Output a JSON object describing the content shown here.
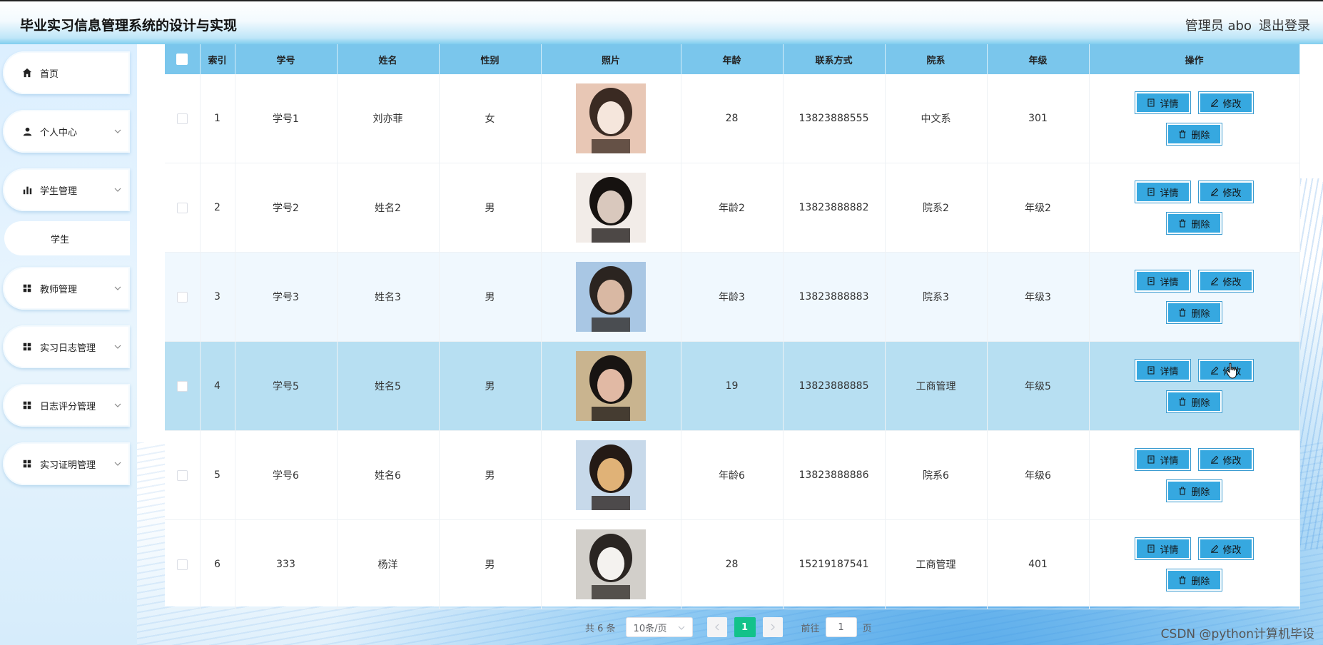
{
  "header": {
    "title": "毕业实习信息管理系统的设计与实现",
    "user": "管理员 abo",
    "logout": "退出登录"
  },
  "sidebar": {
    "items": [
      {
        "label": "首页",
        "icon": "home-icon"
      },
      {
        "label": "个人中心",
        "icon": "user-icon"
      },
      {
        "label": "学生管理",
        "icon": "bar-chart-icon"
      },
      {
        "label": "学生",
        "icon": ""
      },
      {
        "label": "教师管理",
        "icon": "grid-icon"
      },
      {
        "label": "实习日志管理",
        "icon": "grid-icon"
      },
      {
        "label": "日志评分管理",
        "icon": "grid-icon"
      },
      {
        "label": "实习证明管理",
        "icon": "grid-icon"
      }
    ]
  },
  "table": {
    "headers": [
      "",
      "索引",
      "学号",
      "姓名",
      "性别",
      "照片",
      "年龄",
      "联系方式",
      "院系",
      "年级",
      "操作"
    ],
    "rows": [
      {
        "index": "1",
        "id": "学号1",
        "name": "刘亦菲",
        "gender": "女",
        "age": "28",
        "phone": "13823888555",
        "dept": "中文系",
        "grade": "301"
      },
      {
        "index": "2",
        "id": "学号2",
        "name": "姓名2",
        "gender": "男",
        "age": "年龄2",
        "phone": "13823888882",
        "dept": "院系2",
        "grade": "年级2"
      },
      {
        "index": "3",
        "id": "学号3",
        "name": "姓名3",
        "gender": "男",
        "age": "年龄3",
        "phone": "13823888883",
        "dept": "院系3",
        "grade": "年级3"
      },
      {
        "index": "4",
        "id": "学号5",
        "name": "姓名5",
        "gender": "男",
        "age": "19",
        "phone": "13823888885",
        "dept": "工商管理",
        "grade": "年级5"
      },
      {
        "index": "5",
        "id": "学号6",
        "name": "姓名6",
        "gender": "男",
        "age": "年龄6",
        "phone": "13823888886",
        "dept": "院系6",
        "grade": "年级6"
      },
      {
        "index": "6",
        "id": "333",
        "name": "杨洋",
        "gender": "男",
        "age": "28",
        "phone": "15219187541",
        "dept": "工商管理",
        "grade": "401"
      }
    ],
    "buttons": {
      "detail": "详情",
      "edit": "修改",
      "delete": "删除"
    }
  },
  "pagination": {
    "total": "共 6 条",
    "page_size": "10条/页",
    "current": "1",
    "goto_prefix": "前往",
    "goto_value": "1",
    "goto_suffix": "页"
  },
  "watermark": "CSDN @python计算机毕设",
  "colors": {
    "header_accent": "#7ac6ec",
    "button": "#36a8e0",
    "page_active": "#13c28a"
  }
}
